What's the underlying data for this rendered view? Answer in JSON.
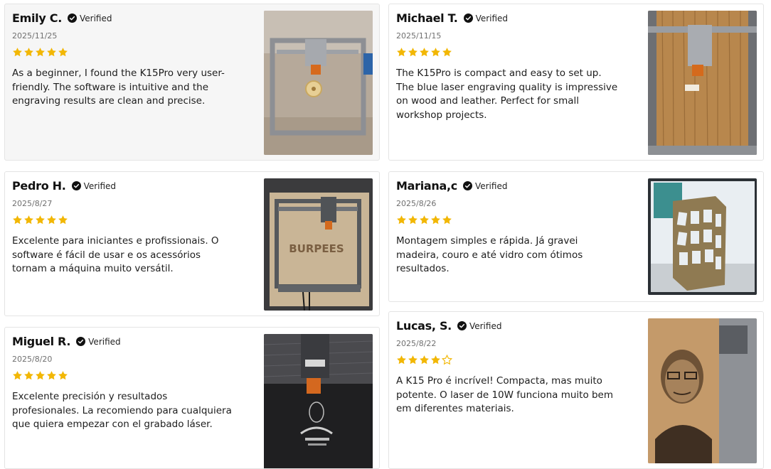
{
  "verified_label": "Verified",
  "star_color": "#f2b705",
  "reviews": [
    {
      "name": "Emily C.",
      "date": "2025/11/25",
      "rating": 5,
      "text": "As a beginner, I found the K15Pro very user-friendly. The software is intuitive and the engraving results are clean and precise.",
      "photo_icon": "laser-engraver-on-floor-photo"
    },
    {
      "name": "Michael T.",
      "date": "2025/11/15",
      "rating": 5,
      "text": "The K15Pro is compact and easy to set up. The blue laser engraving quality is impressive on wood and leather. Perfect for small workshop projects.",
      "photo_icon": "laser-engraver-on-wood-photo"
    },
    {
      "name": "Pedro H.",
      "date": "2025/8/27",
      "rating": 5,
      "text": "Excelente para iniciantes e profissionais. O software é fácil de usar e os acessórios tornam a máquina muito versátil.",
      "photo_icon": "engraved-board-photo",
      "photo_text": "BURPEES"
    },
    {
      "name": "Mariana,c",
      "date": "2025/8/26",
      "rating": 5,
      "text": "Montagem simples e rápida. Já gravei madeira, couro e até vidro com ótimos resultados.",
      "photo_icon": "wooden-lantern-photo"
    },
    {
      "name": "Miguel R.",
      "date": "2025/8/20",
      "rating": 5,
      "text": "Excelente precisión y resultados profesionales. La recomiendo para cualquiera que quiera empezar con el grabado láser.",
      "photo_icon": "engraving-on-fabric-photo"
    },
    {
      "name": "Lucas, S.",
      "date": "2025/8/22",
      "rating": 4,
      "text": "A K15 Pro é incrível! Compacta, mas muito potente. O laser de 10W funciona muito bem em diferentes materiais.",
      "photo_icon": "engraved-portrait-photo"
    }
  ]
}
